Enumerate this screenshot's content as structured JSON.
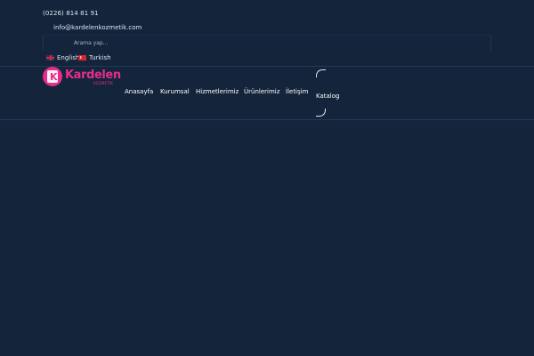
{
  "contact": {
    "phone": "(0226) 814 81 91",
    "email": "info@kardelenkozmetik.com"
  },
  "search": {
    "placeholder": "Arama yap..."
  },
  "languages": [
    {
      "label": "English",
      "flag": "uk-flag-icon"
    },
    {
      "label": "Turkish",
      "flag": "turkey-flag-icon"
    }
  ],
  "brand": {
    "name": "Kardelen",
    "sub": "KOZMETİK",
    "color": "#e62e88"
  },
  "nav": {
    "items": [
      {
        "label": "Anasayfa"
      },
      {
        "label": "Kurumsal"
      },
      {
        "label": "Hizmetlerimiz"
      },
      {
        "label": "Ürünlerimiz"
      },
      {
        "label": "İletişim"
      }
    ],
    "catalog": "Katalog"
  },
  "colors": {
    "background": "#13243b",
    "text": "#ffffff",
    "muted": "#a9b6c6",
    "accent": "#e62e88"
  }
}
